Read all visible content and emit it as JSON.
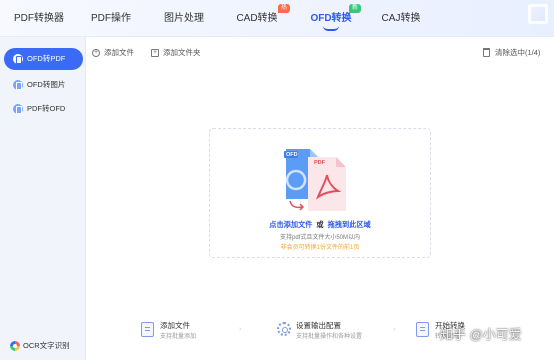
{
  "tabs": [
    {
      "label": "PDF转换器"
    },
    {
      "label": "PDF操作"
    },
    {
      "label": "图片处理"
    },
    {
      "label": "CAD转换",
      "badge": "热"
    },
    {
      "label": "OFD转换",
      "badge": "新"
    },
    {
      "label": "CAJ转换"
    }
  ],
  "sidebar": {
    "items": [
      {
        "label": "OFD转PDF"
      },
      {
        "label": "OFD转图片"
      },
      {
        "label": "PDF转OFD"
      }
    ],
    "ocr_label": "OCR文字识别"
  },
  "toolbar": {
    "add_file": "添加文件",
    "add_folder": "添加文件夹",
    "clear": "清除选中(1/4)"
  },
  "dropzone": {
    "illustration_tag_ofd": "OFD",
    "illustration_tag_pdf": "PDF",
    "main_click": "点击添加文件",
    "main_or": "或",
    "main_drag": "拖拽到此区域",
    "sub": "支持pdf式且文件大小50M以内",
    "note": "非会员可转换1份文件的前1页"
  },
  "steps": [
    {
      "title": "添加文件",
      "desc": "支持批量添加"
    },
    {
      "title": "设置输出配置",
      "desc": "支持批量操作和各种设置"
    },
    {
      "title": "开始转换",
      "desc": "转换完成"
    }
  ],
  "watermark": "知乎 @小可爱",
  "colors": {
    "accent": "#2f5bea",
    "sidebar_active": "#3b6bf6",
    "badge_hot": "#ff6b4a",
    "badge_new": "#3ac77a",
    "note": "#f5a623"
  }
}
